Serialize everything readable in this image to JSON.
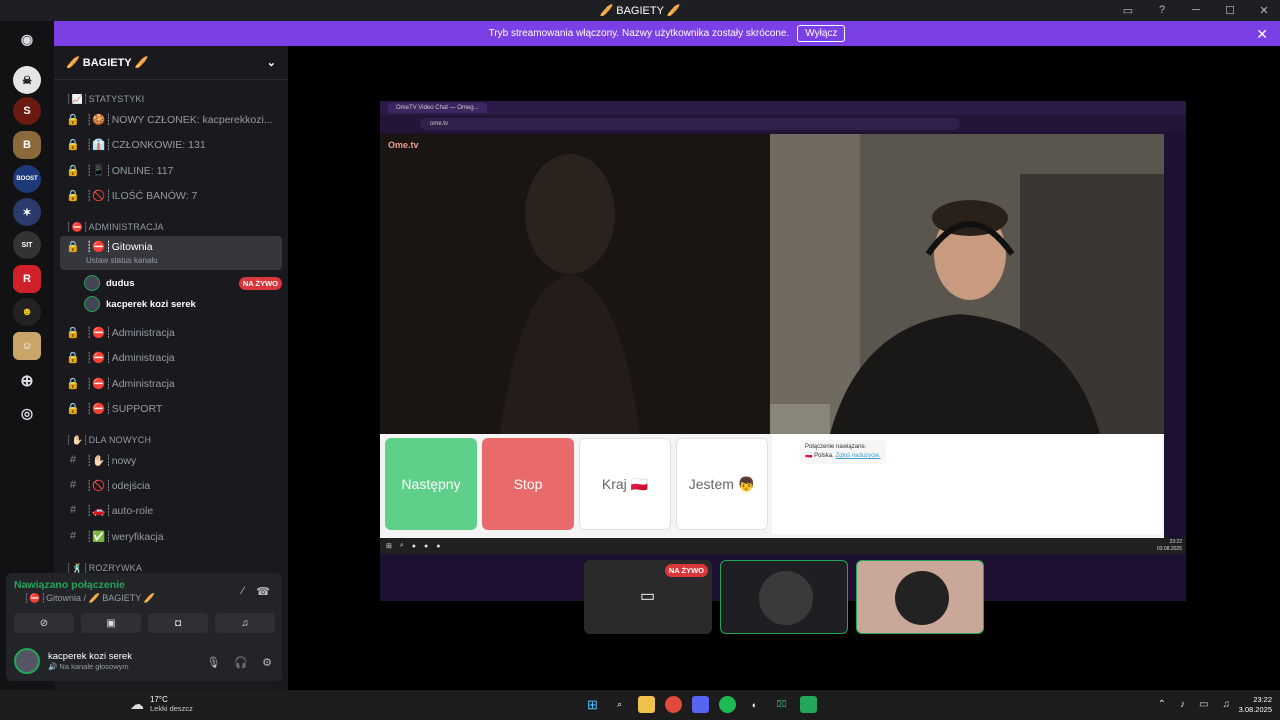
{
  "window": {
    "title": "🥖 BAGIETY 🥖"
  },
  "banner": {
    "text": "Tryb streamowania włączony. Nazwy użytkownika zostały skrócone.",
    "button": "Wyłącz"
  },
  "guild": {
    "name": "🥖 BAGIETY 🥖"
  },
  "categories": {
    "stats": "┊📈┊STATYSTYKI",
    "admin": "┊⛔┊ADMINISTRACJA",
    "newbies": "┊✋🏻┊DLA NOWYCH",
    "fun": "┊🕺┊ROZRYWKA"
  },
  "channels": {
    "stat1": "┊🍪┊NOWY CZŁONEK: kacperekkozi...",
    "stat2": "┊👔┊CZŁONKOWIE: 131",
    "stat3": "┊📱┊ONLINE: 117",
    "stat4": "┊🚫┊ILOŚĆ BANÓW: 7",
    "gitownia": "┊⛔┊Gitownia",
    "gitownia_sub": "Ustaw status kanału",
    "admin1": "┊⛔┊Administracja",
    "admin2": "┊⛔┊Administracja",
    "admin3": "┊⛔┊Administracja",
    "support": "┊⛔┊SUPPORT",
    "nowy": "┊✋🏻┊nowy",
    "odejscia": "┊🚫┊odejścia",
    "autorole": "┊🚗┊auto-role",
    "weryfikacja": "┊✅┊weryfikacja"
  },
  "voice_users": [
    {
      "name": "dudus",
      "badge": "NA ŻYWO"
    },
    {
      "name": "kacperek kozi serek"
    }
  ],
  "voice_panel": {
    "status": "Nawiązano połączenie",
    "channel": "┊⛔┊Gitownia / 🥖 BAGIETY 🥖",
    "user_name": "kacperek kozi serek",
    "user_sub": "🔊 Na kanale głosowym"
  },
  "stream": {
    "tab_title": "OmeTV Video Chat — Omeg...",
    "url": "ome.tv",
    "logo": "Ome.tv",
    "buttons": [
      "Następny",
      "Stop",
      "Kraj 🇵🇱",
      "Jestem 👦"
    ],
    "chat_line1": "Połączenie nawiązane.",
    "chat_line2": "🇵🇱 Polska.",
    "chat_link": "Zgłoś naduzycie.",
    "inner_time": "23:22",
    "inner_date": "03.08.2025",
    "tile_badge": "NA ŻYWO"
  },
  "taskbar": {
    "temp": "17°C",
    "weather": "Lekki deszcz",
    "time": "23:22",
    "date": "3.08.2025"
  },
  "colors": {
    "accent": "#7a40e6",
    "online": "#23a55a",
    "live": "#da373c"
  }
}
